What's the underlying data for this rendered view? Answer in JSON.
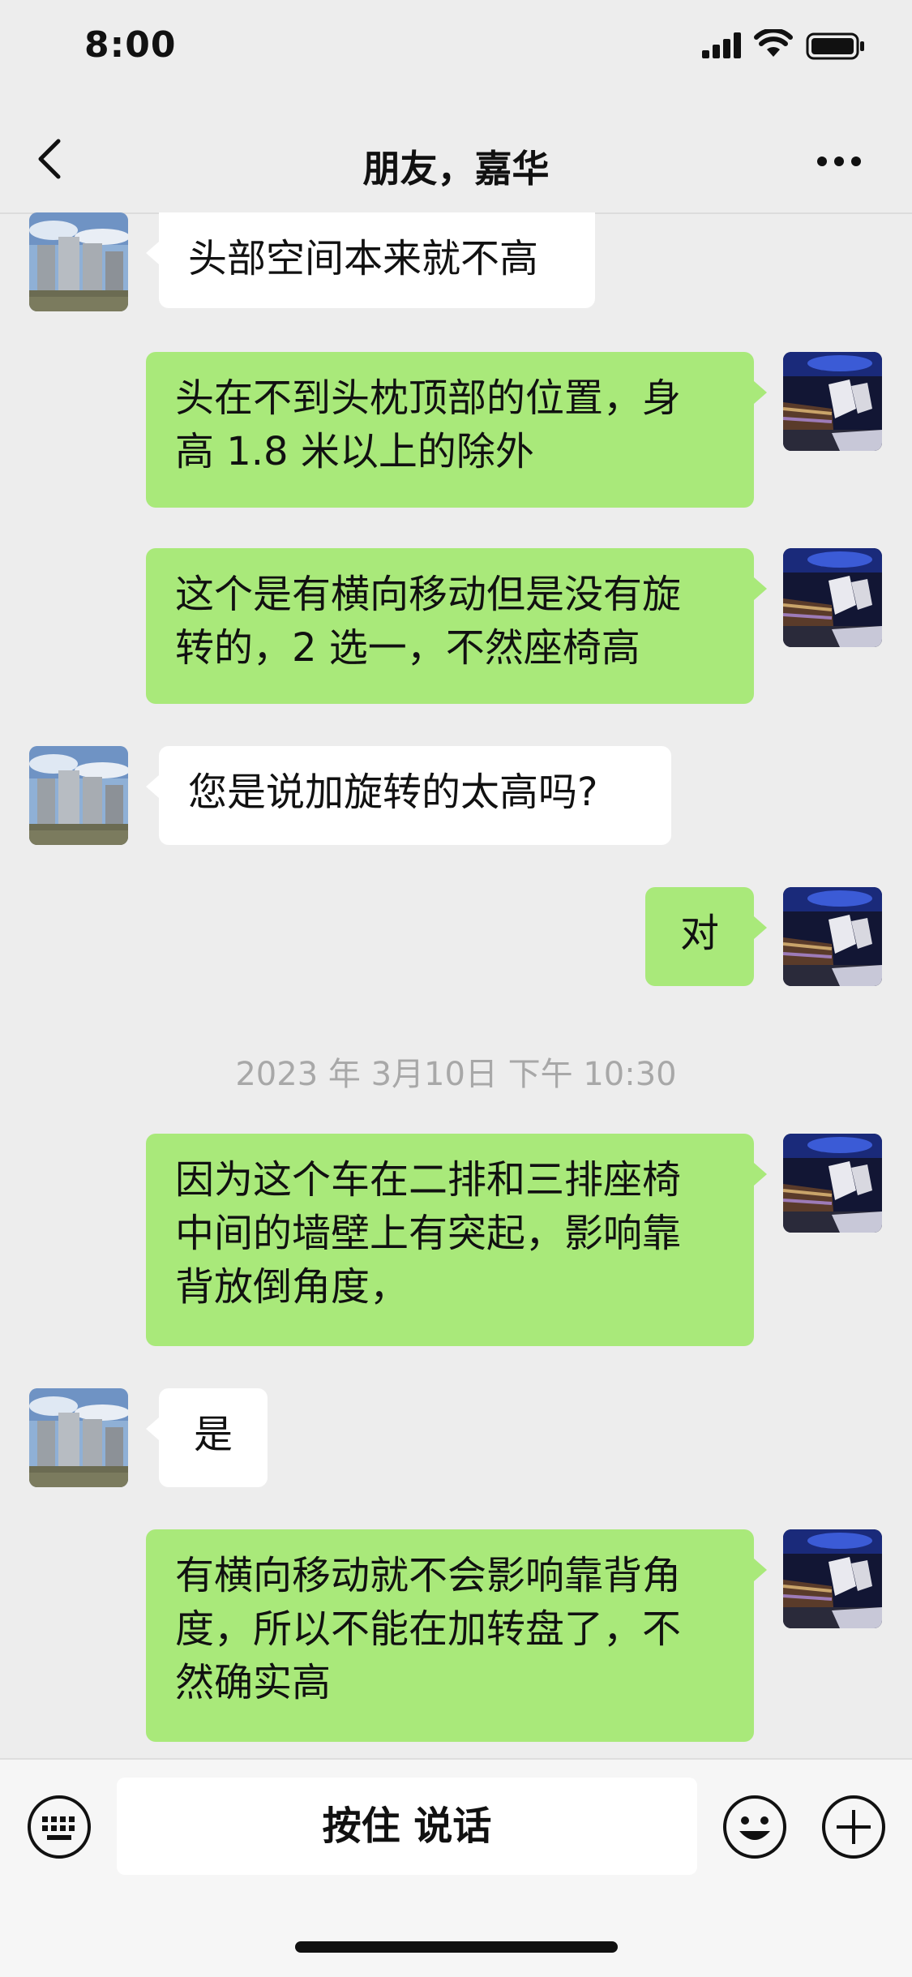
{
  "status_bar": {
    "time": "8:00"
  },
  "header": {
    "title": "朋友，嘉华"
  },
  "messages": [
    {
      "text": "头部空间本来就不高"
    },
    {
      "line1": "头在不到头枕顶部的位置，身",
      "line2": "高 1.8 米以上的除外"
    },
    {
      "line1": "这个是有横向移动但是没有旋",
      "line2": "转的，2 选一，不然座椅高"
    },
    {
      "text": "您是说加旋转的太高吗?"
    },
    {
      "text": "对"
    },
    {
      "line1": "因为这个车在二排和三排座椅",
      "line2": "中间的墙壁上有突起，影响靠",
      "line3": "背放倒角度，"
    },
    {
      "text": "是"
    },
    {
      "line1": "有横向移动就不会影响靠背角",
      "line2": "度，所以不能在加转盘了，不",
      "line3": "然确实高"
    }
  ],
  "timestamp": "2023 年 3月10日 下午 10:30",
  "input_bar": {
    "voice_label": "按住 说话"
  },
  "colors": {
    "background": "#ededed",
    "outgoing_bubble": "#a9e97a",
    "incoming_bubble": "#ffffff"
  },
  "icons": {
    "back": "chevron-left-icon",
    "more": "more-icon",
    "keyboard": "keyboard-icon",
    "emoji": "emoji-icon",
    "plus": "plus-icon",
    "signal": "signal-icon",
    "wifi": "wifi-icon",
    "battery": "battery-icon"
  }
}
